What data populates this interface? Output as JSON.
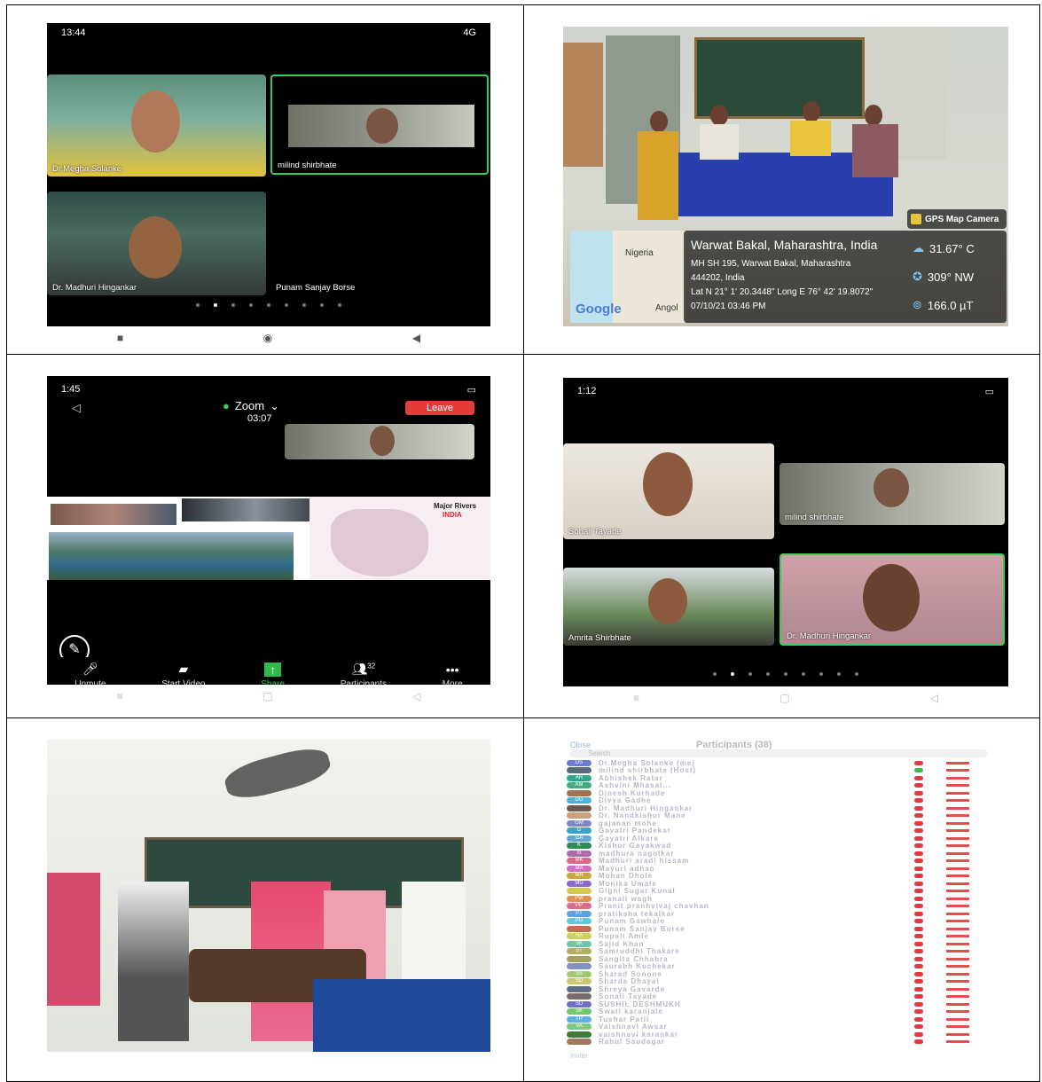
{
  "panel1": {
    "time": "13:44",
    "signal": "4G",
    "battery": "",
    "participants": [
      {
        "name": "Dr.Megha Solanke"
      },
      {
        "name": "milind shirbhate"
      },
      {
        "name": "Dr. Madhuri Hingankar"
      },
      {
        "name": "Punam Sanjay Borse"
      }
    ],
    "page_dots": 9,
    "active_dot": 1
  },
  "panel2": {
    "badge": "GPS Map Camera",
    "map_label": "Nigeria",
    "map_label2": "Angol",
    "map_brand": "Google",
    "place": "Warwat Bakal, Maharashtra, India",
    "address_line1": "MH SH 195, Warwat Bakal, Maharashtra",
    "address_line2": "444202, India",
    "coords": "Lat N 21° 1' 20.3448\" Long E 76° 42' 19.8072\"",
    "datetime": "07/10/21 03:46 PM",
    "temperature": "31.67° C",
    "wind": "309° NW",
    "magnetic": "166.0 µT"
  },
  "panel3": {
    "time": "1:45",
    "app": "Zoom",
    "timer": "03:07",
    "leave": "Leave",
    "map_title": "Major Rivers",
    "map_subtitle": "INDIA",
    "toolbar": {
      "unmute": "Unmute",
      "start_video": "Start Video",
      "share": "Share",
      "participants": "Participants",
      "participants_count": "32",
      "more": "More"
    }
  },
  "panel4": {
    "time": "1:12",
    "participants": [
      {
        "name": "Sonali Tayade"
      },
      {
        "name": "milind shirbhate"
      },
      {
        "name": "Amrita  Shirbhate"
      },
      {
        "name": "Dr. Madhuri Hingankar"
      }
    ],
    "page_dots": 9,
    "active_dot": 1
  },
  "panel6": {
    "close": "Close",
    "title": "Participants (38)",
    "search": "Search",
    "invite": "Invite",
    "rows": [
      {
        "initials": "DS",
        "color": "#6c7cd6",
        "name": "Dr.Megha Solanke (me)"
      },
      {
        "initials": "",
        "color": "#556b7a",
        "name": "milind shirbhate (Host)"
      },
      {
        "initials": "AR",
        "color": "#31a88a",
        "name": "Abhishek Ratar"
      },
      {
        "initials": "AM",
        "color": "#3fb07c",
        "name": "Ashvini Mhasal..."
      },
      {
        "initials": "",
        "color": "#a07050",
        "name": "Dinesh Kurhade"
      },
      {
        "initials": "DG",
        "color": "#4fb0d8",
        "name": "Divya Gadhe"
      },
      {
        "initials": "",
        "color": "#6a5a50",
        "name": "Dr. Madhuri Hingankar"
      },
      {
        "initials": "",
        "color": "#c8a080",
        "name": "Dr. Nandkishor Mane"
      },
      {
        "initials": "GM",
        "color": "#7e84c8",
        "name": "gajanan mohe"
      },
      {
        "initials": "G",
        "color": "#3fa0c8",
        "name": "Gayatri Pandekar"
      },
      {
        "initials": "GA",
        "color": "#5fa8d8",
        "name": "Gayatri Alkare"
      },
      {
        "initials": "K",
        "color": "#2e8b57",
        "name": "Kishor Gayakwad"
      },
      {
        "initials": "m",
        "color": "#b06ab0",
        "name": "madhura nagolkar"
      },
      {
        "initials": "MK",
        "color": "#d86a8a",
        "name": "Madhuri aradi hissam"
      },
      {
        "initials": "MA",
        "color": "#d070c0",
        "name": "Mayuri adhao"
      },
      {
        "initials": "MR",
        "color": "#c8a83e",
        "name": "Mohan Dhole"
      },
      {
        "initials": "MU",
        "color": "#8e6ad0",
        "name": "Monika Umale"
      },
      {
        "initials": "",
        "color": "#d8c84e",
        "name": "Gigni Sugar Kunal"
      },
      {
        "initials": "PW",
        "color": "#e09050",
        "name": "pranali wagh"
      },
      {
        "initials": "PP",
        "color": "#e06a8a",
        "name": "Pranit pranhvivaj chavhan"
      },
      {
        "initials": "PT",
        "color": "#5ea0e0",
        "name": "pratiksha tekalkar"
      },
      {
        "initials": "PG",
        "color": "#5ec8d8",
        "name": "Punam Gawhale"
      },
      {
        "initials": "",
        "color": "#c07050",
        "name": "Punam Sanjay Borse"
      },
      {
        "initials": "RA",
        "color": "#d0d05e",
        "name": "Rupali Amle"
      },
      {
        "initials": "SK",
        "color": "#6ec8a8",
        "name": "Sajid Khan"
      },
      {
        "initials": "ST",
        "color": "#b0b05e",
        "name": "Samruddhi Thakare"
      },
      {
        "initials": "",
        "color": "#a8a05e",
        "name": "Sangita Chhabra"
      },
      {
        "initials": "",
        "color": "#8090c0",
        "name": "Saurabh Kuchekar"
      },
      {
        "initials": "SS",
        "color": "#a0c870",
        "name": "Sharad Sonone"
      },
      {
        "initials": "SD",
        "color": "#c8c870",
        "name": "Sharda Dhayal"
      },
      {
        "initials": "",
        "color": "#5e6e80",
        "name": "Shreya Gavarde"
      },
      {
        "initials": "",
        "color": "#7a6a6a",
        "name": "Sonali Tayade"
      },
      {
        "initials": "SD",
        "color": "#6e70c8",
        "name": "SUSHIL DESHMUKH"
      },
      {
        "initials": "SK",
        "color": "#6ec86e",
        "name": "Swati karanjale"
      },
      {
        "initials": "TP",
        "color": "#5eb0e0",
        "name": "Tushar Patil"
      },
      {
        "initials": "VA",
        "color": "#7ec880",
        "name": "Vaishnavi Awsar"
      },
      {
        "initials": "",
        "color": "#3e7a3e",
        "name": "vaishnavi karankar"
      },
      {
        "initials": "",
        "color": "#a07a5e",
        "name": "Rahul Saudagar"
      }
    ]
  }
}
